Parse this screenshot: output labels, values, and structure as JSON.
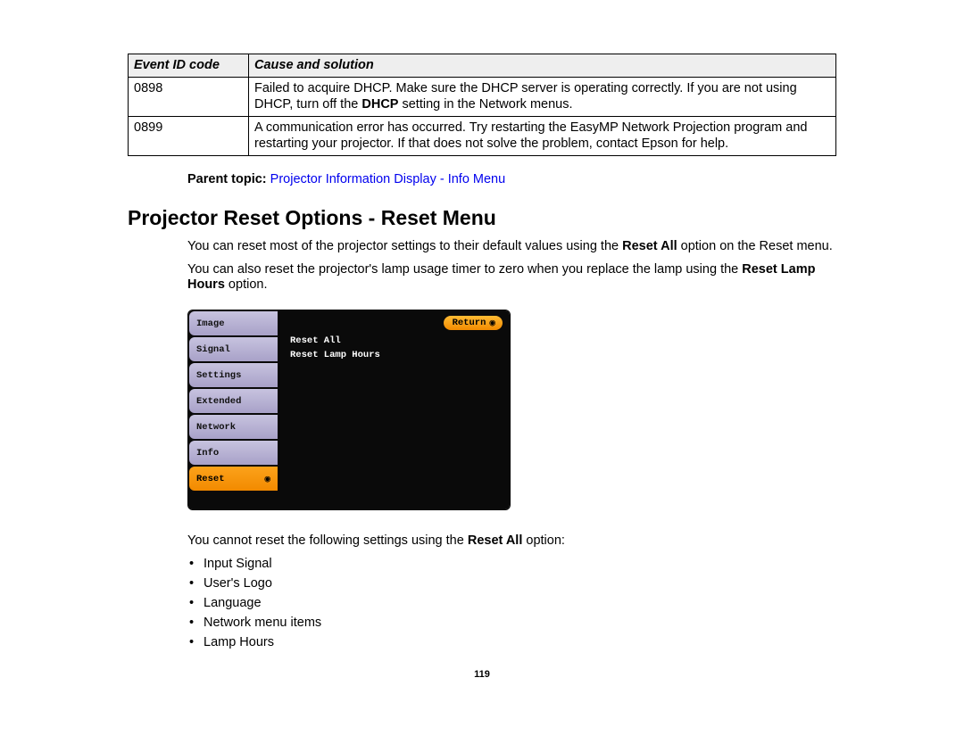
{
  "table": {
    "headers": {
      "code": "Event ID code",
      "cause": "Cause and solution"
    },
    "rows": [
      {
        "code": "0898",
        "cause_pre": "Failed to acquire DHCP. Make sure the DHCP server is operating correctly. If you are not using DHCP, turn off the ",
        "cause_bold": "DHCP",
        "cause_post": " setting in the Network menus."
      },
      {
        "code": "0899",
        "cause_pre": "A communication error has occurred. Try restarting the EasyMP Network Projection program and restarting your projector. If that does not solve the problem, contact Epson for help.",
        "cause_bold": "",
        "cause_post": ""
      }
    ]
  },
  "parent_topic": {
    "label": "Parent topic:",
    "link": "Projector Information Display - Info Menu"
  },
  "heading": "Projector Reset Options - Reset Menu",
  "para1": {
    "pre": "You can reset most of the projector settings to their default values using the ",
    "bold": "Reset All",
    "post": " option on the Reset menu."
  },
  "para2": {
    "pre": "You can also reset the projector's lamp usage timer to zero when you replace the lamp using the ",
    "bold": "Reset Lamp Hours",
    "post": " option."
  },
  "osd": {
    "tabs": [
      "Image",
      "Signal",
      "Settings",
      "Extended",
      "Network",
      "Info",
      "Reset"
    ],
    "return_label": "Return",
    "items": [
      "Reset All",
      "Reset Lamp Hours"
    ]
  },
  "para3": {
    "pre": "You cannot reset the following settings using the ",
    "bold": "Reset All",
    "post": " option:"
  },
  "list": [
    "Input Signal",
    "User's Logo",
    "Language",
    "Network menu items",
    "Lamp Hours"
  ],
  "page_number": "119"
}
